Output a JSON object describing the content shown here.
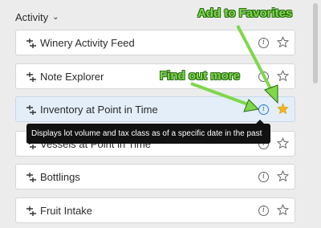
{
  "header": {
    "title": "Activity",
    "chevron_icon": "chevron-down-icon"
  },
  "cards": [
    {
      "label": "Winery Activity Feed"
    },
    {
      "label": "Note Explorer"
    },
    {
      "label": "Inventory at Point in Time",
      "active": true
    },
    {
      "label": "Vessels at Point in Time"
    },
    {
      "label": "Bottlings"
    },
    {
      "label": "Fruit Intake"
    }
  ],
  "tooltip": {
    "text": "Displays lot volume and tax class as of a specific date in the past"
  },
  "annotations": {
    "favorites": "Add to Favorites",
    "info": "Find out more"
  },
  "colors": {
    "annotation": "#7ed84a",
    "active_card": "#e3eef8",
    "info_active": "#2c7ed6",
    "star_favorite": "#f3b623"
  }
}
